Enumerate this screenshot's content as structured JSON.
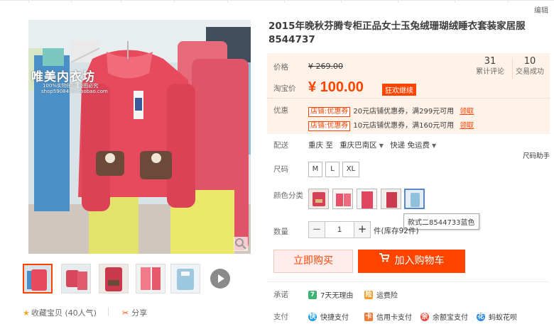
{
  "header": {
    "edit_label": "编辑"
  },
  "gallery": {
    "watermark": "唯美内衣坊",
    "watermark_sub": "100%实物拍摄 盗图必究",
    "watermark_url": "shop59084097taobao.com",
    "thumbnails": [
      "thumb-1",
      "thumb-2",
      "thumb-3",
      "thumb-4",
      "thumb-5"
    ],
    "favorite_label": "收藏宝贝 (40人气)",
    "share_label": "分享"
  },
  "product": {
    "title_line1": "2015年晚秋芬腾专柜正品女士玉兔绒珊瑚绒睡衣套装家居服",
    "title_line2": "8544737"
  },
  "pricing": {
    "price_label": "价格",
    "original_price": "¥ 269.00",
    "sale_label": "淘宝价",
    "sale_price": "¥ 100.00",
    "promo_tag": "狂欢继续",
    "reviews_count": "31",
    "reviews_label": "累计评论",
    "deals_count": "10",
    "deals_label": "交易成功",
    "coupon_label": "优惠",
    "coupons": [
      {
        "tag": "店铺:优惠券",
        "text": "20元店铺优惠券，满299元可用",
        "claim": "领取"
      },
      {
        "tag": "店铺:优惠券",
        "text": "10元店铺优惠券，满160元可用",
        "claim": "领取"
      }
    ]
  },
  "shipping": {
    "label": "配送",
    "from": "重庆 至",
    "to": "重庆巴南区",
    "method": "快递 免运费",
    "assistant_label": "尺码助手"
  },
  "size": {
    "label": "尺码",
    "options": [
      "M",
      "L",
      "XL"
    ]
  },
  "color": {
    "label": "颜色分类",
    "tooltip": "款式二8544733蓝色",
    "swatches": [
      "swatch-1",
      "swatch-2",
      "swatch-3",
      "swatch-4",
      "swatch-5"
    ]
  },
  "quantity": {
    "label": "数量",
    "value": "1",
    "minus": "−",
    "plus": "+",
    "stock_text": "件(库存92件)"
  },
  "actions": {
    "buy_now": "立即购买",
    "add_to_cart": "加入购物车"
  },
  "promise": {
    "label": "承诺",
    "items": [
      {
        "icon": "7",
        "text": "7天无理由"
      },
      {
        "icon": "险",
        "text": "运费险"
      }
    ]
  },
  "payment": {
    "label": "支付",
    "items": [
      {
        "icon": "快",
        "text": "快捷支付"
      },
      {
        "icon": "卡",
        "text": "信用卡支付"
      },
      {
        "icon": "余",
        "text": "余额宝支付"
      },
      {
        "icon": "花",
        "text": "蚂蚁花呗"
      }
    ]
  },
  "colors": {
    "accent": "#ff4400",
    "panel_bg": "#fff2e8",
    "swatch_selected": "#5a87c9"
  }
}
